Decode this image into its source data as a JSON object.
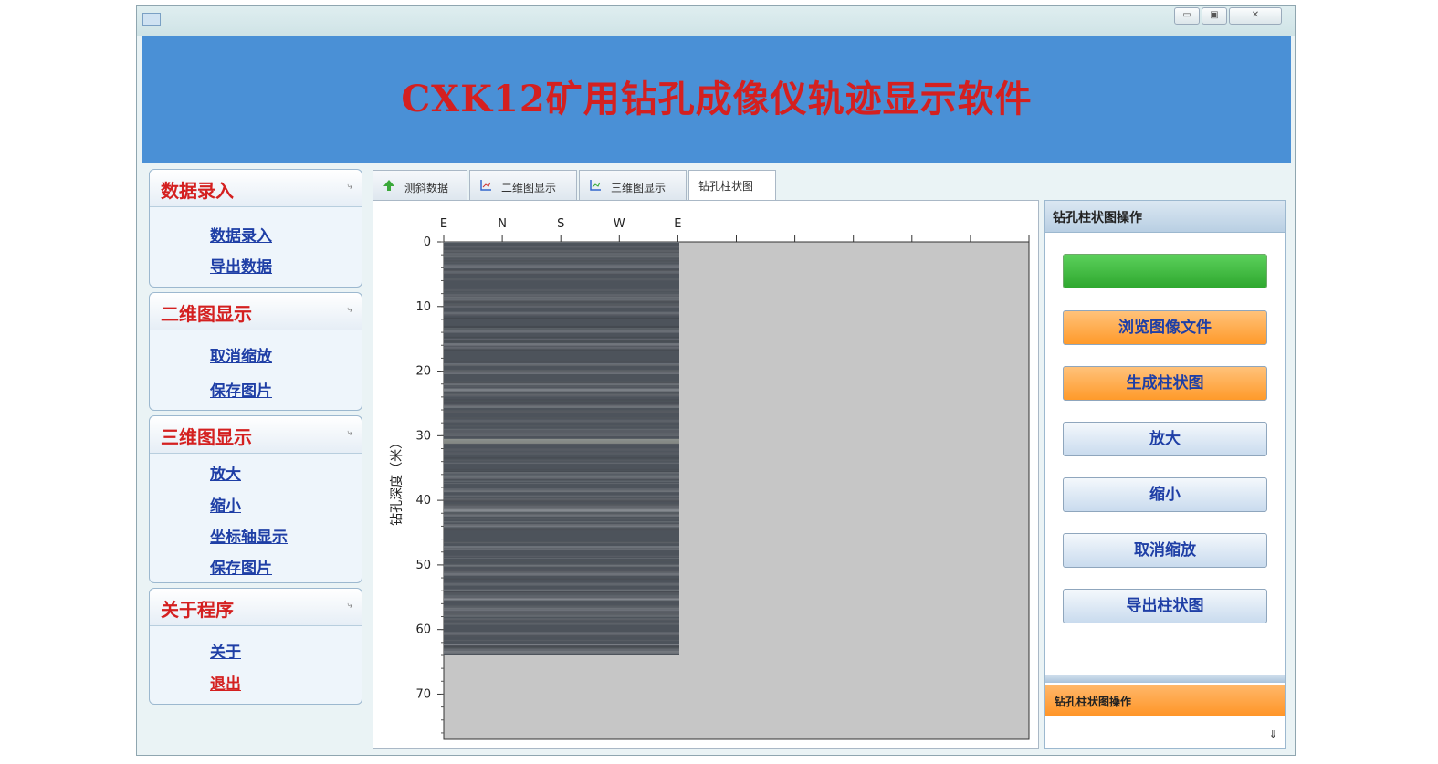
{
  "app": {
    "title": "CXK12矿用钻孔成像仪轨迹显示软件"
  },
  "window_controls": {
    "minimize": "▭",
    "maximize": "▣",
    "close": "✕"
  },
  "sidebar": {
    "collapse_glyph": "⤷",
    "groups": [
      {
        "title": "数据录入",
        "items": [
          "数据录入",
          "导出数据"
        ]
      },
      {
        "title": "二维图显示",
        "items": [
          "取消缩放",
          "保存图片"
        ]
      },
      {
        "title": "三维图显示",
        "items": [
          "放大",
          "缩小",
          "坐标轴显示",
          "保存图片"
        ]
      },
      {
        "title": "关于程序",
        "items": [
          "关于",
          "退出"
        ]
      }
    ]
  },
  "tabs": [
    {
      "label": "测斜数据",
      "icon": "green-arrow-up-icon"
    },
    {
      "label": "二维图显示",
      "icon": "chart-icon"
    },
    {
      "label": "三维图显示",
      "icon": "chart-icon"
    },
    {
      "label": "钻孔柱状图",
      "icon": ""
    }
  ],
  "active_tab": 3,
  "chart_data": {
    "type": "heatmap",
    "x_ticks": [
      "E",
      "N",
      "S",
      "W",
      "E"
    ],
    "ylabel": "钻孔深度（米）",
    "y_ticks": [
      0,
      10,
      20,
      30,
      40,
      50,
      60,
      70
    ],
    "ylim": [
      0,
      77
    ],
    "image_depth_range": [
      0,
      64
    ],
    "description_colors": {
      "plot_bg": "#c6c6c6",
      "core": "#4a5058"
    }
  },
  "panel": {
    "title": "钻孔柱状图操作",
    "progress_fraction": 1.0,
    "buttons": [
      {
        "label": "浏览图像文件",
        "style": "orange"
      },
      {
        "label": "生成柱状图",
        "style": "orange"
      },
      {
        "label": "放大",
        "style": "blue"
      },
      {
        "label": "缩小",
        "style": "blue"
      },
      {
        "label": "取消缩放",
        "style": "blue"
      },
      {
        "label": "导出柱状图",
        "style": "blue"
      }
    ],
    "collapsed_section_title": "钻孔柱状图操作",
    "expand_glyph": "⇓"
  },
  "colors": {
    "header_bg": "#4a90d6",
    "title_red": "#d42020",
    "link_blue": "#1f3fa6",
    "accent_orange": "#ff9a2a",
    "progress_green": "#3cbc3c"
  }
}
